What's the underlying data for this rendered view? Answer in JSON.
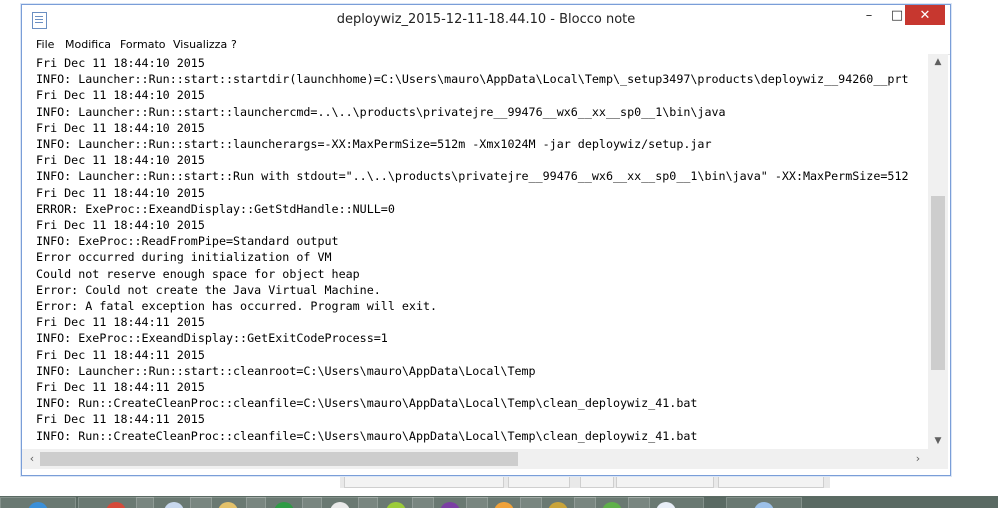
{
  "window": {
    "title": "deploywiz_2015-12-11-18.44.10 - Blocco note",
    "controls": {
      "minimize_glyph": "–",
      "maximize_glyph": "□",
      "close_glyph": "✕"
    }
  },
  "menu": {
    "items": [
      "File",
      "Modifica",
      "Formato",
      "Visualizza",
      "?"
    ]
  },
  "document": {
    "lines": [
      "Fri Dec 11 18:44:10 2015",
      "INFO: Launcher::Run::start::startdir(launchhome)=C:\\Users\\mauro\\AppData\\Local\\Temp\\_setup3497\\products\\deploywiz__94260__prt",
      "Fri Dec 11 18:44:10 2015",
      "INFO: Launcher::Run::start::launchercmd=..\\..\\products\\privatejre__99476__wx6__xx__sp0__1\\bin\\java",
      "Fri Dec 11 18:44:10 2015",
      "INFO: Launcher::Run::start::launcherargs=-XX:MaxPermSize=512m -Xmx1024M -jar deploywiz/setup.jar",
      "Fri Dec 11 18:44:10 2015",
      "INFO: Launcher::Run::start::Run with stdout=\"..\\..\\products\\privatejre__99476__wx6__xx__sp0__1\\bin\\java\" -XX:MaxPermSize=512",
      "Fri Dec 11 18:44:10 2015",
      "ERROR: ExeProc::ExeandDisplay::GetStdHandle::NULL=0",
      "Fri Dec 11 18:44:10 2015",
      "INFO: ExeProc::ReadFromPipe=Standard output",
      "Error occurred during initialization of VM",
      "Could not reserve enough space for object heap",
      "Error: Could not create the Java Virtual Machine.",
      "Error: A fatal exception has occurred. Program will exit.",
      "Fri Dec 11 18:44:11 2015",
      "INFO: ExeProc::ExeandDisplay::GetExitCodeProcess=1",
      "Fri Dec 11 18:44:11 2015",
      "INFO: Launcher::Run::start::cleanroot=C:\\Users\\mauro\\AppData\\Local\\Temp",
      "Fri Dec 11 18:44:11 2015",
      "INFO: Run::CreateCleanProc::cleanfile=C:\\Users\\mauro\\AppData\\Local\\Temp\\clean_deploywiz_41.bat",
      "Fri Dec 11 18:44:11 2015",
      "INFO: Run::CreateCleanProc::cleanfile=C:\\Users\\mauro\\AppData\\Local\\Temp\\clean_deploywiz_41.bat"
    ]
  },
  "scrollbars": {
    "up_arrow": "▲",
    "down_arrow": "▼",
    "left_arrow": "‹",
    "right_arrow": "›"
  },
  "colors": {
    "close_button": "#c7372f",
    "window_border": "#7a9ed8",
    "taskbar": "#5a6a63"
  },
  "taskbar": {
    "icons": [
      "ie-icon",
      "chrome-icon",
      "app-icon",
      "app-icon",
      "app-icon",
      "app-icon",
      "app-icon",
      "app-icon",
      "app-icon",
      "app-icon",
      "app-icon",
      "app-icon",
      "app-icon"
    ]
  }
}
